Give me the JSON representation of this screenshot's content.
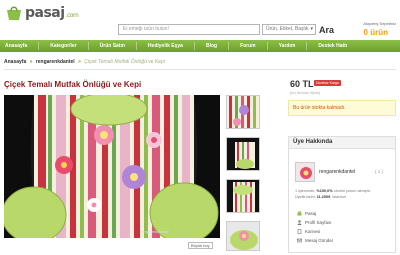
{
  "header": {
    "logo_text": "pasaj",
    "logo_suffix": ".com",
    "search_placeholder": "Ei emeği ürün bulun!",
    "search_scope": "Ürün, Etiket, Başlık",
    "search_button": "Ara",
    "cart_label": "Alışveriş Sepetiniz",
    "cart_amount": "0 ürün"
  },
  "nav": {
    "items": [
      "Anasayfa",
      "Kategoriler",
      "Ürün Satın",
      "Hediyelik Eşya",
      "Blog",
      "Forum",
      "Yardım",
      "Destek Hattı"
    ]
  },
  "breadcrumb": {
    "home": "Anasayfa",
    "sep": "»",
    "user": "rengarenkdantel",
    "current": "Çiçek Temalı Mutfak Önlüğü ve Kepi"
  },
  "product": {
    "title": "Çiçek Temalı Mutfak Önlüğü ve Kepi",
    "price": "60 TL",
    "badge": "Ücretsiz Kargo",
    "price_note": "(bu ürünün fiyatı)",
    "stock_message": "Bu ürün stokta kalmadı.",
    "watermark": "rengarenkdantel",
    "zoom_label": "Büyük boy"
  },
  "seller": {
    "heading": "Üye Hakkında",
    "name": "rengarenkdantel",
    "rating": "( 1 )",
    "stat_line1_prefix": "1 işleminde, ",
    "stat_line1_value": "%100,0%",
    "stat_line1_suffix": " olumlu yorum almıştır.",
    "stat_line2_prefix": "Üyelik tarihi: ",
    "stat_line2_value": "11.2009",
    "stat_line2_suffix": ", İstanbul",
    "links": [
      "Pasaj",
      "Profil Sayfası",
      "Karnesi",
      "Mesaj Gönder"
    ]
  },
  "colors": {
    "brand_green": "#7aa53a",
    "title_red": "#8b1a1a",
    "cart_orange": "#f39c12",
    "badge_red": "#d83a3a"
  }
}
